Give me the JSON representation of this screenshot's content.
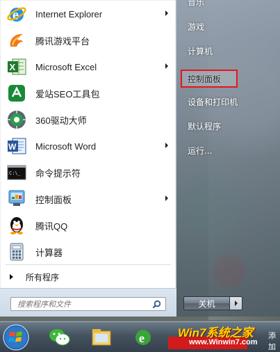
{
  "programs": [
    {
      "label": "Internet Explorer",
      "icon": "internet-explorer-icon",
      "submenu": true
    },
    {
      "label": "腾讯游戏平台",
      "icon": "tencent-game-icon",
      "submenu": false
    },
    {
      "label": "Microsoft Excel",
      "icon": "excel-icon",
      "submenu": true
    },
    {
      "label": "爱站SEO工具包",
      "icon": "aizhan-seo-icon",
      "submenu": false
    },
    {
      "label": "360驱动大师",
      "icon": "360-driver-icon",
      "submenu": false
    },
    {
      "label": "Microsoft Word",
      "icon": "word-icon",
      "submenu": true
    },
    {
      "label": "命令提示符",
      "icon": "cmd-icon",
      "submenu": false
    },
    {
      "label": "控制面板",
      "icon": "control-panel-icon",
      "submenu": true
    },
    {
      "label": "腾讯QQ",
      "icon": "qq-penguin-icon",
      "submenu": false
    },
    {
      "label": "计算器",
      "icon": "calculator-icon",
      "submenu": false
    }
  ],
  "all_programs": "所有程序",
  "search": {
    "placeholder": "搜索程序和文件"
  },
  "right_links": {
    "top_partial": "音乐",
    "games": "游戏",
    "computer": "计算机",
    "control_panel": "控制面板",
    "devices_printers": "设备和打印机",
    "default_programs": "默认程序",
    "run": "运行..."
  },
  "shutdown": {
    "label": "关机"
  },
  "watermark": {
    "brand": "Win7系统之家",
    "url": "www.Winwin7.com",
    "side": "添加"
  },
  "colors": {
    "highlight_border": "#e8141b",
    "right_pane": "#5f6e7d"
  }
}
